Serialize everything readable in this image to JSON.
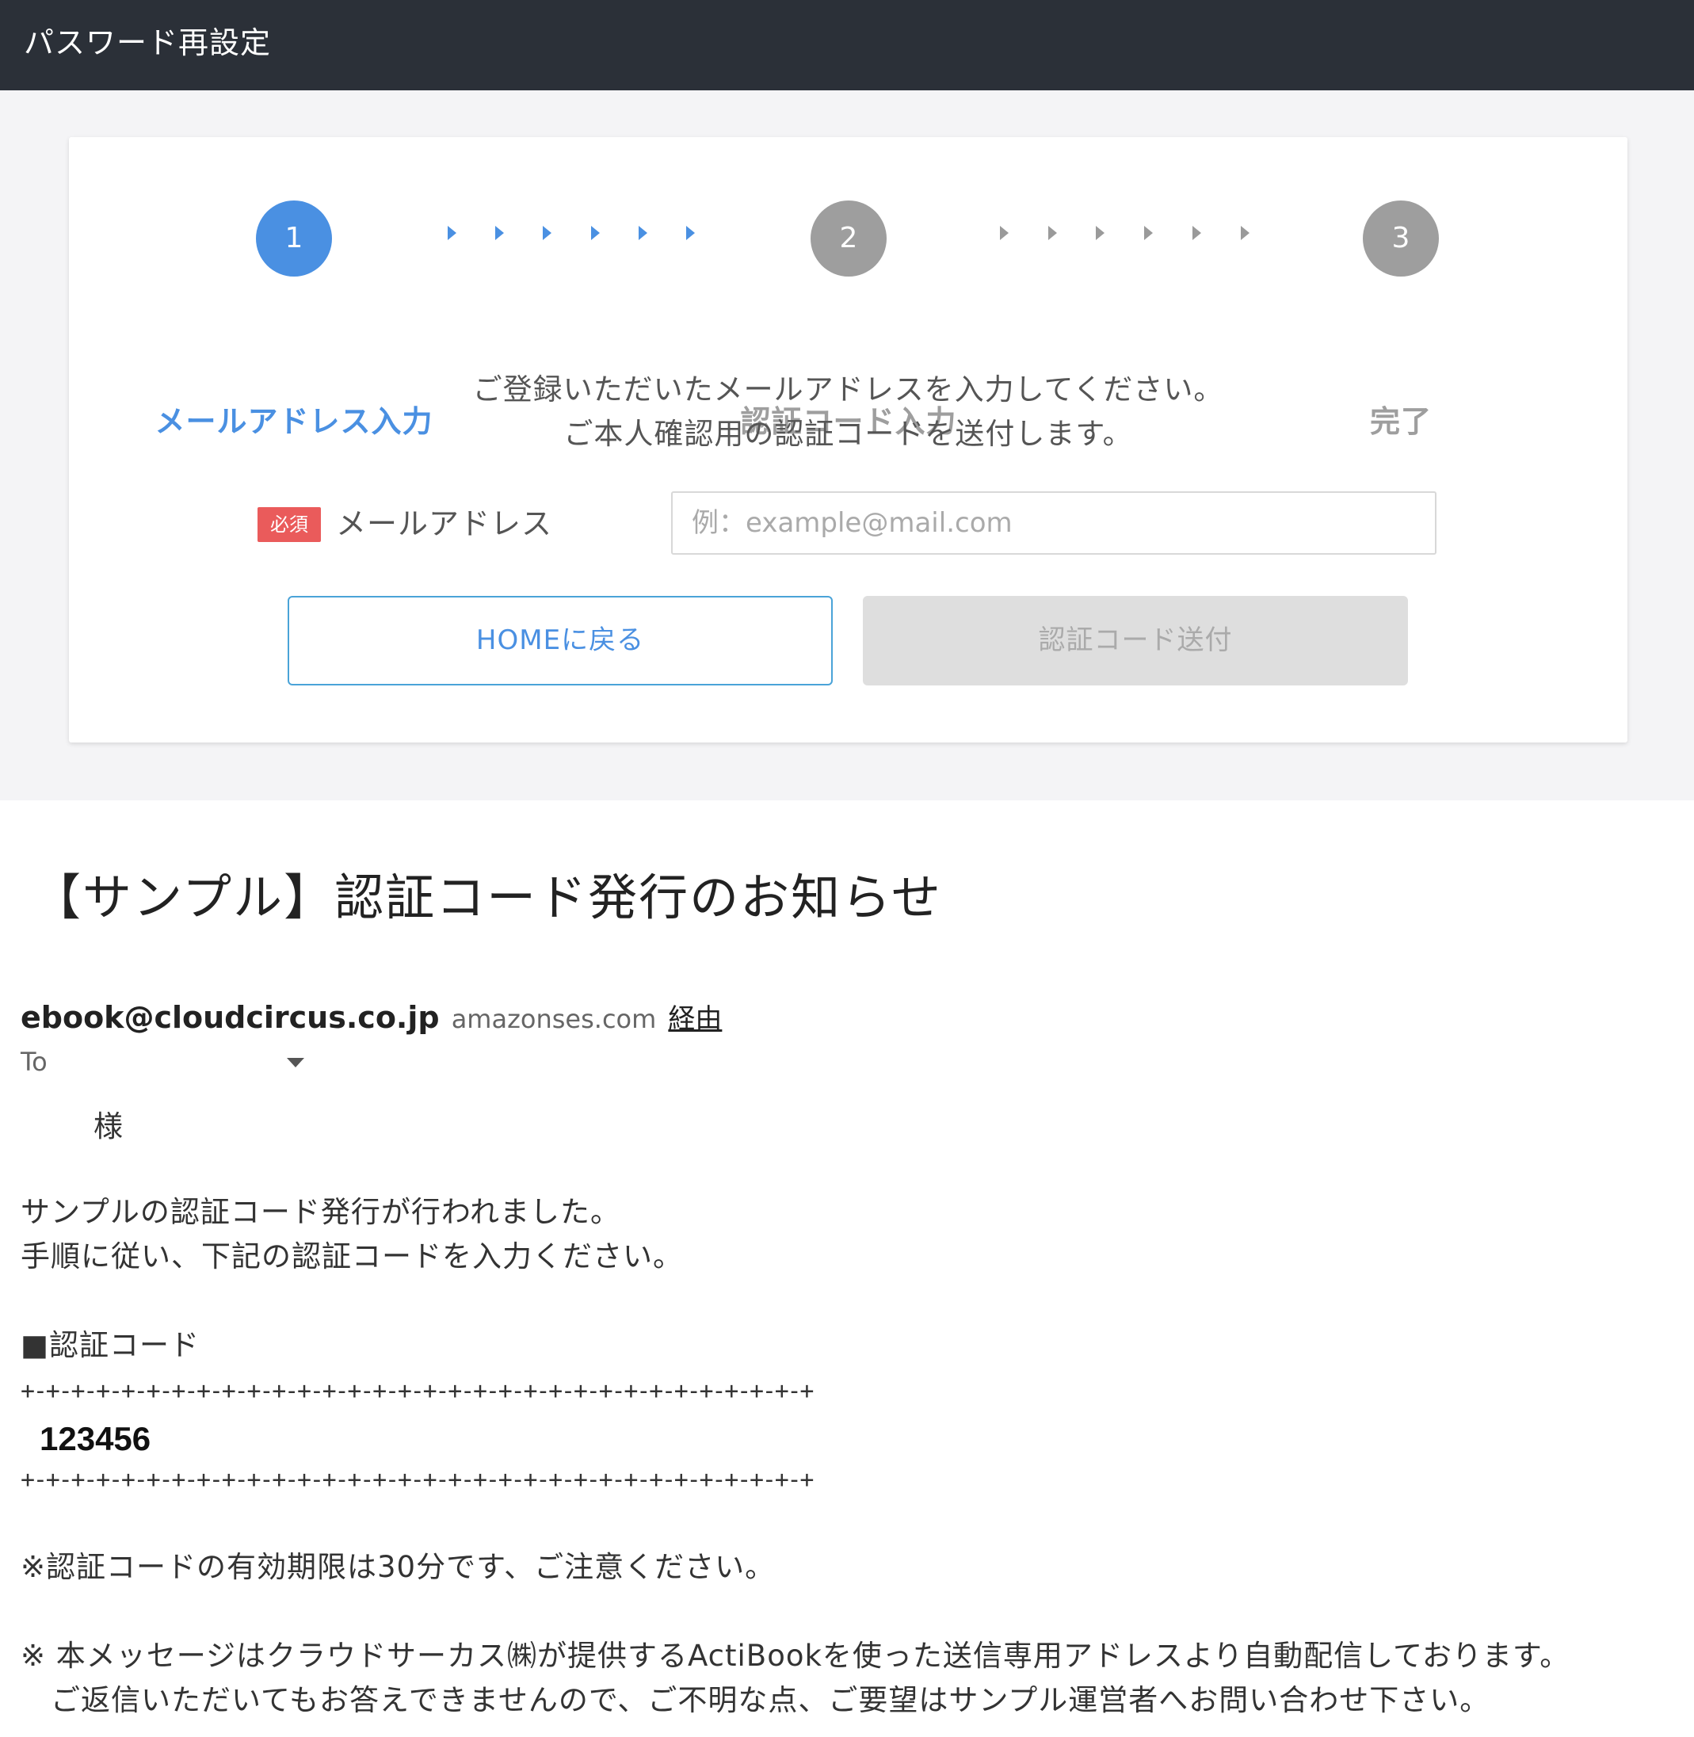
{
  "header": {
    "title": "パスワード再設定"
  },
  "stepper": {
    "steps": [
      {
        "number": "1",
        "label": "メールアドレス入力",
        "state": "active",
        "color": "#4a90e2"
      },
      {
        "number": "2",
        "label": "認証コード入力",
        "state": "pending",
        "color": "#9e9e9e"
      },
      {
        "number": "3",
        "label": "完了",
        "state": "pending",
        "color": "#9e9e9e"
      }
    ]
  },
  "instructions": {
    "line1": "ご登録いただいたメールアドレスを入力してください。",
    "line2": "ご本人確認用の認証コードを送付します。"
  },
  "form": {
    "required_badge": "必須",
    "email_label": "メールアドレス",
    "email_placeholder": "例：example@mail.com",
    "email_value": ""
  },
  "buttons": {
    "home": "HOMEに戻る",
    "send_code": "認証コード送付",
    "send_code_disabled": true
  },
  "email": {
    "subject": "【サンプル】認証コード発行のお知らせ",
    "sender_address": "ebook@cloudcircus.co.jp",
    "sender_via_domain": "amazonses.com",
    "sender_via_word": "経由",
    "to_label": "To",
    "salutation": "様",
    "body_line1": "サンプルの認証コード発行が行われました。",
    "body_line2": "手順に従い、下記の認証コードを入力ください。",
    "code_heading": "■認証コード",
    "divider": "+-+-+-+-+-+-+-+-+-+-+-+-+-+-+-+-+-+-+-+-+-+-+-+-+-+-+-+-+-+-+-+",
    "code": "123456",
    "note_validity": "※認証コードの有効期限は30分です、ご注意ください。",
    "footer_line1": "※ 本メッセージはクラウドサーカス㈱が提供するActiBookを使った送信専用アドレスより自動配信しております。",
    "footer_line2": "　ご返信いただいてもお答えできませんので、ご不明な点、ご要望はサンプル運営者へお問い合わせ下さい。"
  }
}
